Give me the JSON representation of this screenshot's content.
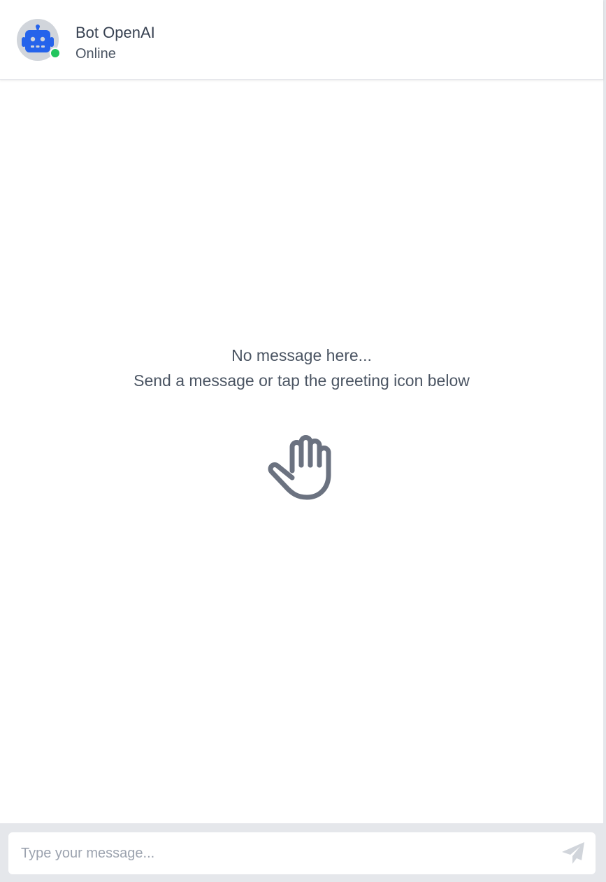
{
  "header": {
    "bot_name": "Bot OpenAI",
    "status": "Online",
    "avatar_icon": "robot-icon",
    "status_color": "#22c55e"
  },
  "empty_state": {
    "line1": "No message here...",
    "line2": "Send a message or tap the greeting icon below",
    "greeting_icon": "hand-wave-icon"
  },
  "composer": {
    "placeholder": "Type your message...",
    "value": "",
    "send_icon": "paper-plane-icon"
  },
  "colors": {
    "accent": "#2563eb",
    "icon_gray": "#6b7280",
    "footer_bg": "#e5e7eb"
  }
}
